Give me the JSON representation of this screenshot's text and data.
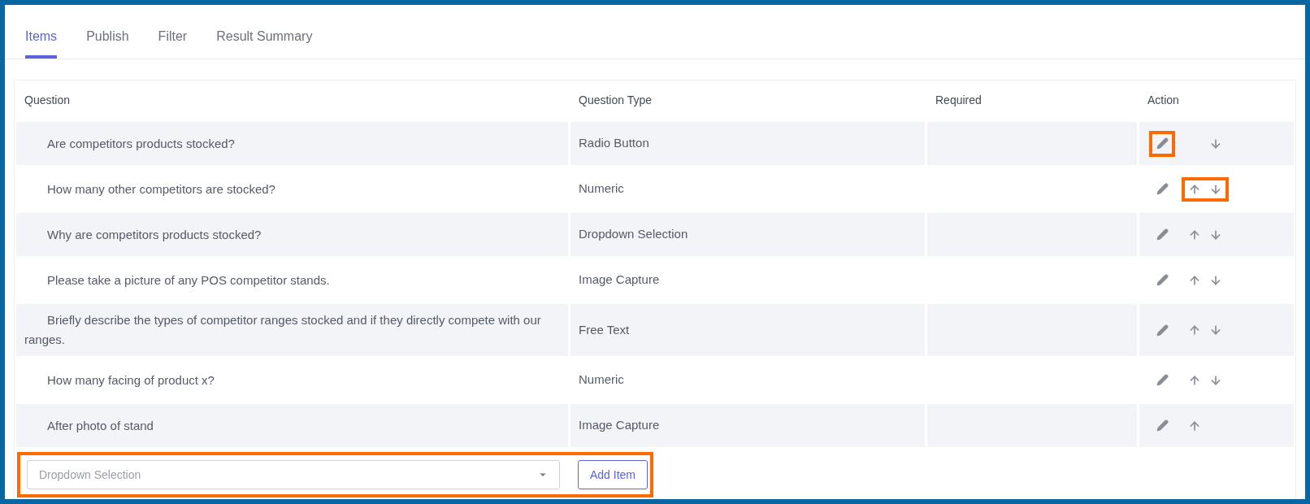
{
  "tabs": [
    {
      "label": "Items",
      "selected": true
    },
    {
      "label": "Publish",
      "selected": false
    },
    {
      "label": "Filter",
      "selected": false
    },
    {
      "label": "Result Summary",
      "selected": false
    }
  ],
  "table": {
    "columns": [
      "Question",
      "Question Type",
      "Required",
      "Action"
    ],
    "rows": [
      {
        "question": "Are competitors products stocked?",
        "type": "Radio Button",
        "up": false,
        "down": true,
        "edit_highlighted": true,
        "arrows_highlighted": false
      },
      {
        "question": "How many other competitors are stocked?",
        "type": "Numeric",
        "up": true,
        "down": true,
        "edit_highlighted": false,
        "arrows_highlighted": true
      },
      {
        "question": "Why are competitors products stocked?",
        "type": "Dropdown Selection",
        "up": true,
        "down": true,
        "edit_highlighted": false,
        "arrows_highlighted": false
      },
      {
        "question": "Please take a picture of any POS competitor stands.",
        "type": "Image Capture",
        "up": true,
        "down": true,
        "edit_highlighted": false,
        "arrows_highlighted": false
      },
      {
        "question": "Briefly describe the types of competitor ranges stocked and if they directly compete with our ranges.",
        "type": "Free Text",
        "up": true,
        "down": true,
        "edit_highlighted": false,
        "arrows_highlighted": false
      },
      {
        "question": "How many facing of product x?",
        "type": "Numeric",
        "up": true,
        "down": true,
        "edit_highlighted": false,
        "arrows_highlighted": false
      },
      {
        "question": "After photo of stand",
        "type": "Image Capture",
        "up": true,
        "down": false,
        "edit_highlighted": false,
        "arrows_highlighted": false
      }
    ]
  },
  "new_item": {
    "placeholder": "Dropdown Selection",
    "button": "Add Item",
    "highlighted": true
  }
}
